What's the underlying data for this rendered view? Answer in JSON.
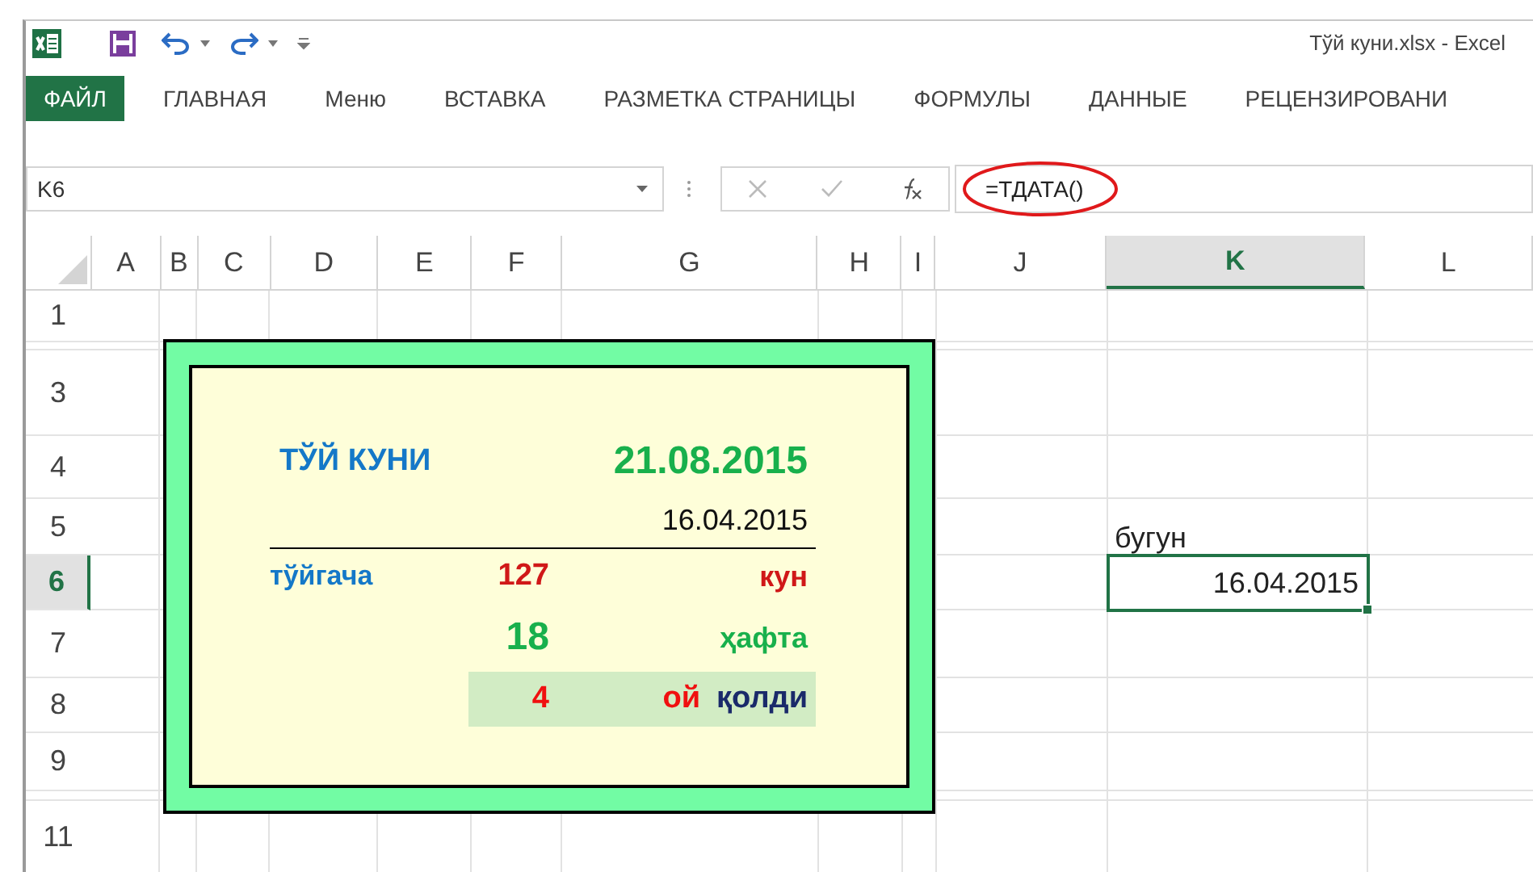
{
  "window": {
    "title": "Тўй куни.xlsx - Excel"
  },
  "ribbon_tabs": [
    {
      "label": "ФАЙЛ",
      "kind": "file"
    },
    {
      "label": "ГЛАВНАЯ",
      "kind": "tab"
    },
    {
      "label": "Меню",
      "kind": "tab"
    },
    {
      "label": "ВСТАВКА",
      "kind": "tab"
    },
    {
      "label": "РАЗМЕТКА СТРАНИЦЫ",
      "kind": "tab"
    },
    {
      "label": "ФОРМУЛЫ",
      "kind": "tab"
    },
    {
      "label": "ДАННЫЕ",
      "kind": "tab"
    },
    {
      "label": "РЕЦЕНЗИРОВАНИ",
      "kind": "tab"
    }
  ],
  "name_box": "K6",
  "formula": {
    "text": "=ТДАТА()",
    "circled": true
  },
  "columns": [
    {
      "label": "A",
      "selected": false
    },
    {
      "label": "B",
      "selected": false
    },
    {
      "label": "C",
      "selected": false
    },
    {
      "label": "D",
      "selected": false
    },
    {
      "label": "E",
      "selected": false
    },
    {
      "label": "F",
      "selected": false
    },
    {
      "label": "G",
      "selected": false
    },
    {
      "label": "H",
      "selected": false
    },
    {
      "label": "I",
      "selected": false
    },
    {
      "label": "J",
      "selected": false
    },
    {
      "label": "K",
      "selected": true
    },
    {
      "label": "L",
      "selected": false
    }
  ],
  "rows": [
    {
      "label": "1",
      "selected": false
    },
    {
      "selected": false
    },
    {
      "label": "3",
      "selected": false
    },
    {
      "label": "4",
      "selected": false
    },
    {
      "label": "5",
      "selected": false
    },
    {
      "label": "6",
      "selected": true
    },
    {
      "label": "7",
      "selected": false
    },
    {
      "label": "8",
      "selected": false
    },
    {
      "label": "9",
      "selected": false
    },
    {
      "selected": false
    },
    {
      "label": "11",
      "selected": false
    }
  ],
  "card": {
    "title": "ТЎЙ КУНИ",
    "wedding_date": "21.08.2015",
    "today": "16.04.2015",
    "until_label": "тўйгача",
    "days": "127",
    "days_unit": "кун",
    "weeks": "18",
    "weeks_unit": "ҳафта",
    "months": "4",
    "months_unit": "ой",
    "left_label": "қолди"
  },
  "k5": "бугун",
  "k6": {
    "text": "16.04.2015",
    "selected": true
  }
}
